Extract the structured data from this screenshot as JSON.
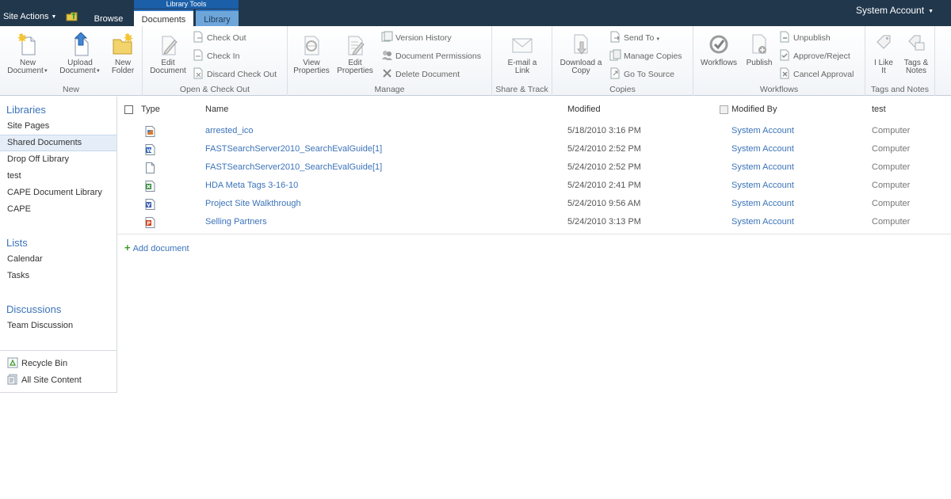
{
  "topbar": {
    "site_actions": "Site Actions",
    "browse_tab": "Browse",
    "context_group": "Library Tools",
    "tab_documents": "Documents",
    "tab_library": "Library",
    "account": "System Account",
    "colors": {
      "bar": "#21374c",
      "context": "#1a5fa8",
      "library_tab": "#6ea6d9"
    }
  },
  "ribbon": {
    "groups": {
      "new": {
        "label": "New",
        "new_document": [
          "New",
          "Document"
        ],
        "upload_document": [
          "Upload",
          "Document"
        ],
        "new_folder": [
          "New",
          "Folder"
        ]
      },
      "open": {
        "label": "Open & Check Out",
        "edit_document": [
          "Edit",
          "Document"
        ],
        "check_out": "Check Out",
        "check_in": "Check In",
        "discard_check_out": "Discard Check Out"
      },
      "manage": {
        "label": "Manage",
        "view_properties": [
          "View",
          "Properties"
        ],
        "edit_properties": [
          "Edit",
          "Properties"
        ],
        "version_history": "Version History",
        "document_permissions": "Document Permissions",
        "delete_document": "Delete Document"
      },
      "share": {
        "label": "Share & Track",
        "email_link": [
          "E-mail a",
          "Link"
        ]
      },
      "copies": {
        "label": "Copies",
        "download_copy": [
          "Download a",
          "Copy"
        ],
        "send_to": "Send To",
        "manage_copies": "Manage Copies",
        "go_to_source": "Go To Source"
      },
      "workflows": {
        "label": "Workflows",
        "workflows": "Workflows",
        "publish": "Publish",
        "unpublish": "Unpublish",
        "approve_reject": "Approve/Reject",
        "cancel_approval": "Cancel Approval"
      },
      "tags": {
        "label": "Tags and Notes",
        "i_like_it": [
          "I Like",
          "It"
        ],
        "tags_notes": [
          "Tags &",
          "Notes"
        ]
      }
    }
  },
  "leftnav": {
    "libraries_heading": "Libraries",
    "libraries": [
      "Site Pages",
      "Shared Documents",
      "Drop Off Library",
      "test",
      "CAPE Document Library",
      "CAPE"
    ],
    "lists_heading": "Lists",
    "lists": [
      "Calendar",
      "Tasks"
    ],
    "discussions_heading": "Discussions",
    "discussions": [
      "Team Discussion"
    ],
    "recycle_bin": "Recycle Bin",
    "all_site_content": "All Site Content"
  },
  "list": {
    "columns": {
      "type": "Type",
      "name": "Name",
      "modified": "Modified",
      "modified_by": "Modified By",
      "test": "test"
    },
    "rows": [
      {
        "icon": "image-file-icon",
        "name": "arrested_ico",
        "modified": "5/18/2010 3:16 PM",
        "modified_by": "System Account",
        "test": "Computer"
      },
      {
        "icon": "word-doc-icon",
        "name": "FASTSearchServer2010_SearchEvalGuide[1]",
        "modified": "5/24/2010 2:52 PM",
        "modified_by": "System Account",
        "test": "Computer"
      },
      {
        "icon": "generic-file-icon",
        "name": "FASTSearchServer2010_SearchEvalGuide[1]",
        "modified": "5/24/2010 2:52 PM",
        "modified_by": "System Account",
        "test": "Computer"
      },
      {
        "icon": "excel-doc-icon",
        "name": "HDA Meta Tags 3-16-10",
        "modified": "5/24/2010 2:41 PM",
        "modified_by": "System Account",
        "test": "Computer"
      },
      {
        "icon": "visio-doc-icon",
        "name": "Project Site Walkthrough",
        "modified": "5/24/2010 9:56 AM",
        "modified_by": "System Account",
        "test": "Computer"
      },
      {
        "icon": "powerpoint-doc-icon",
        "name": "Selling Partners",
        "modified": "5/24/2010 3:13 PM",
        "modified_by": "System Account",
        "test": "Computer"
      }
    ],
    "add_document": "Add document"
  }
}
